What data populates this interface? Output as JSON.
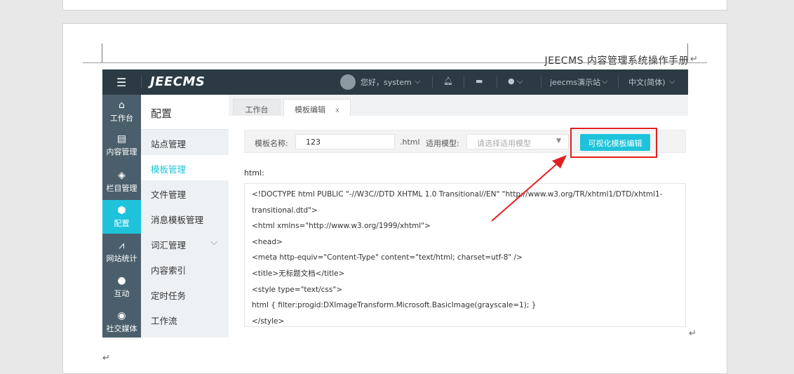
{
  "doc": {
    "header": "JEECMS 内容管理系统操作手册"
  },
  "app": {
    "logo": "JEECMS",
    "topbar": {
      "greeting": "您好，system",
      "site": "jeecms演示站",
      "language": "中文(简体)"
    },
    "iconbar": [
      {
        "icon": "home-icon",
        "label": "工作台"
      },
      {
        "icon": "document-icon",
        "label": "内容管理"
      },
      {
        "icon": "layers-icon",
        "label": "栏目管理"
      },
      {
        "icon": "cube-icon",
        "label": "配置",
        "active": true
      },
      {
        "icon": "chart-icon",
        "label": "网站统计"
      },
      {
        "icon": "chat-icon",
        "label": "互动"
      },
      {
        "icon": "share-icon",
        "label": "社交媒体"
      }
    ],
    "sidebar": {
      "title": "配置",
      "items": [
        {
          "label": "站点管理"
        },
        {
          "label": "模板管理",
          "active": true
        },
        {
          "label": "文件管理"
        },
        {
          "label": "消息模板管理"
        },
        {
          "label": "词汇管理"
        },
        {
          "label": "内容索引"
        },
        {
          "label": "定时任务"
        },
        {
          "label": "工作流"
        }
      ]
    },
    "tabs": [
      {
        "label": "工作台"
      },
      {
        "label": "模板编辑",
        "close": "x"
      }
    ],
    "form": {
      "name_label": "模板名称:",
      "name_value": "123",
      "suffix": ".html",
      "model_label": "适用模型:",
      "model_placeholder": "请选择适用模型",
      "visual_button": "可视化模板编辑"
    },
    "code_label": "html:",
    "code_lines": [
      "<!DOCTYPE html PUBLIC \"-//W3C//DTD XHTML 1.0 Transitional//EN\" \"http://www.w3.org/TR/xhtml1/DTD/xhtml1-",
      "transitional.dtd\">",
      "<html xmlns=\"http://www.w3.org/1999/xhtml\">",
      "<head>",
      "<meta http-equiv=\"Content-Type\" content=\"text/html; charset=utf-8\" />",
      "<title>无标题文档</title>",
      "<style type=\"text/css\">",
      "html { filter:progid:DXImageTransform.Microsoft.BasicImage(grayscale=1); }",
      "</style>"
    ]
  },
  "colors": {
    "accent": "#1ec3db",
    "annotation": "#e02020",
    "topbar": "#2c3b43"
  }
}
